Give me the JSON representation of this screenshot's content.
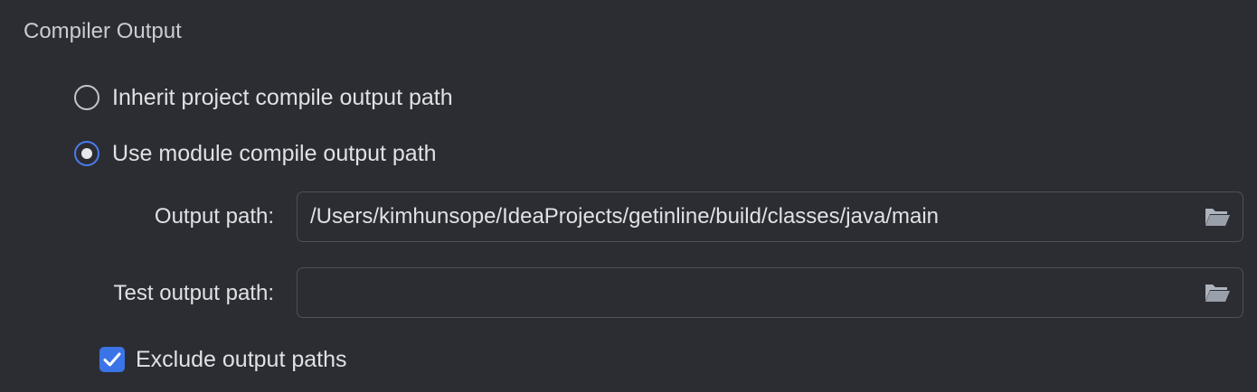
{
  "section": {
    "title": "Compiler Output"
  },
  "options": {
    "inherit": {
      "label": "Inherit project compile output path",
      "selected": false
    },
    "module": {
      "label": "Use module compile output path",
      "selected": true
    }
  },
  "output_path": {
    "label": "Output path:",
    "value": "/Users/kimhunsope/IdeaProjects/getinline/build/classes/java/main",
    "browse_icon": "folder-open-icon"
  },
  "test_output_path": {
    "label": "Test output path:",
    "value": "",
    "browse_icon": "folder-open-icon"
  },
  "exclude": {
    "label": "Exclude output paths",
    "checked": true
  },
  "colors": {
    "background": "#2b2d33",
    "accent": "#3b74e6",
    "text": "#dfe1e5",
    "field_border": "#4e5157"
  }
}
